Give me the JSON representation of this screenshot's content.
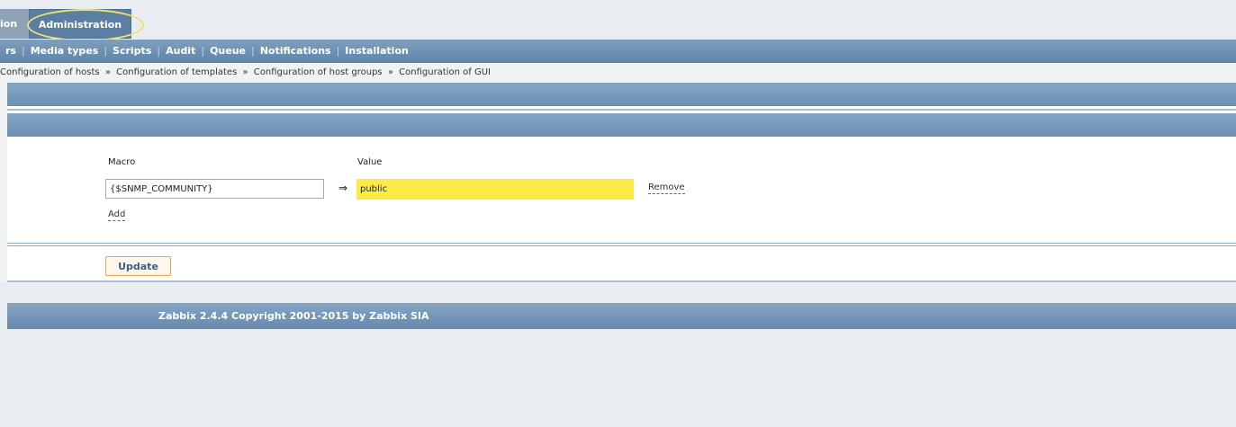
{
  "top_tabs": {
    "previous_tab_fragment": "ion",
    "active_tab": "Administration"
  },
  "submenu": {
    "items": [
      "rs",
      "Media types",
      "Scripts",
      "Audit",
      "Queue",
      "Notifications",
      "Installation"
    ],
    "separator": "|"
  },
  "breadcrumb": {
    "items": [
      "Configuration of hosts",
      "Configuration of templates",
      "Configuration of host groups",
      "Configuration of GUI"
    ],
    "separator": "»"
  },
  "macros": {
    "macro_header": "Macro",
    "value_header": "Value",
    "rows": [
      {
        "macro": "{$SNMP_COMMUNITY}",
        "arrow": "⇒",
        "value": "public",
        "remove_label": "Remove"
      }
    ],
    "add_label": "Add"
  },
  "form": {
    "update_label": "Update"
  },
  "footer": {
    "text": "Zabbix 2.4.4 Copyright 2001-2015 by Zabbix SIA"
  },
  "colors": {
    "highlight_value_field": "#fceb47",
    "highlight_ring": "#f1e36a",
    "header_bar": "#6b8fb3",
    "update_border": "#f0a54a"
  }
}
